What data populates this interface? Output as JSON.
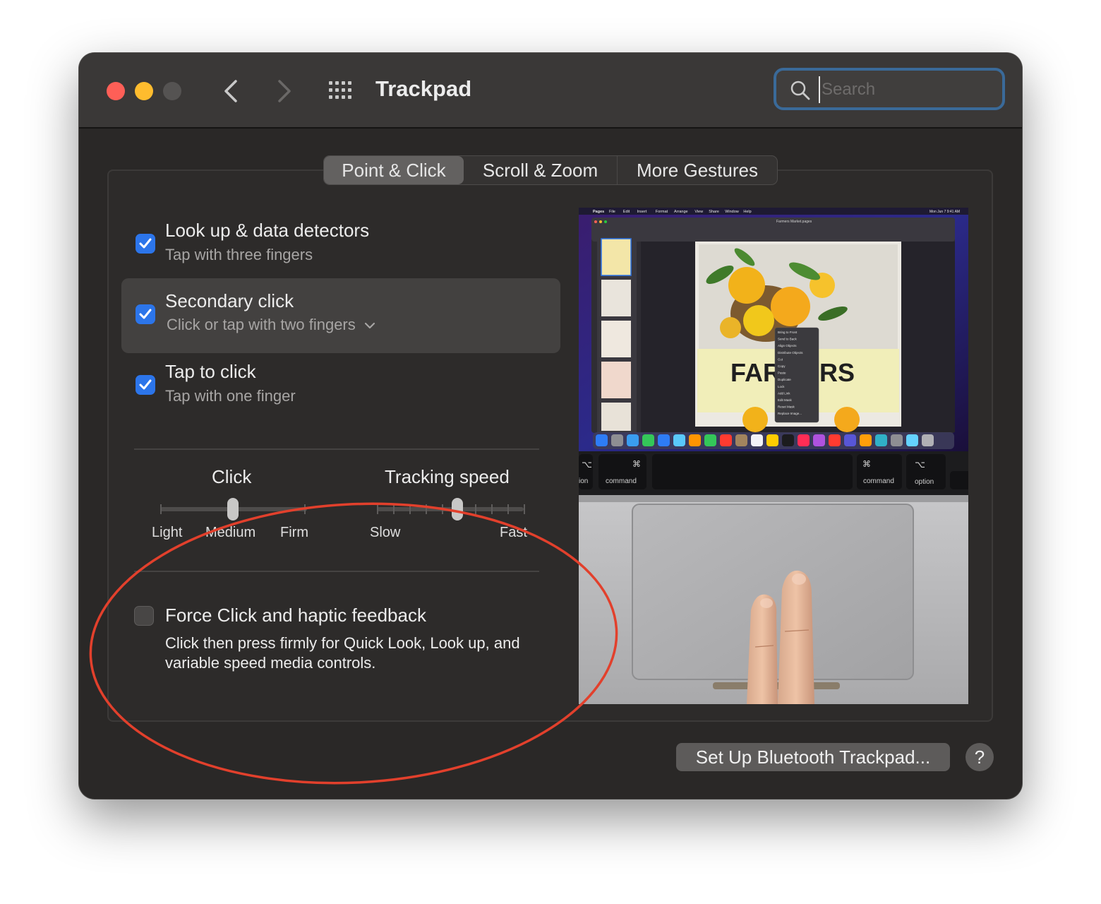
{
  "window": {
    "title": "Trackpad",
    "search_placeholder": "Search"
  },
  "tabs": [
    {
      "label": "Point & Click",
      "selected": true
    },
    {
      "label": "Scroll & Zoom",
      "selected": false
    },
    {
      "label": "More Gestures",
      "selected": false
    }
  ],
  "options": {
    "lookup": {
      "label": "Look up & data detectors",
      "sub": "Tap with three fingers",
      "checked": true
    },
    "secondary": {
      "label": "Secondary click",
      "sub": "Click or tap with two fingers",
      "checked": true
    },
    "tap": {
      "label": "Tap to click",
      "sub": "Tap with one finger",
      "checked": true
    }
  },
  "click_slider": {
    "title": "Click",
    "labels": [
      "Light",
      "Medium",
      "Firm"
    ],
    "value": "Medium"
  },
  "tracking_slider": {
    "title": "Tracking speed",
    "min_label": "Slow",
    "max_label": "Fast",
    "value_fraction": 0.55
  },
  "force_click": {
    "label": "Force Click and haptic feedback",
    "description": "Click then press firmly for Quick Look, Look up, and variable speed media controls.",
    "checked": false
  },
  "preview": {
    "menubar": [
      "Pages",
      "File",
      "Edit",
      "Insert",
      "Format",
      "Arrange",
      "View",
      "Share",
      "Window",
      "Help"
    ],
    "menubar_time": "Mon Jun 7  9:41 AM",
    "doc_title": "Farmers Market.pages",
    "poster_title": "FARMERS",
    "context_menu": [
      "Bring to Front",
      "Send to Back",
      "Align Objects",
      "Distribute Objects",
      "Cut",
      "Copy",
      "Paste",
      "Duplicate",
      "Lock",
      "Add Link",
      "Edit Mask",
      "Reset Mask",
      "Replace Image..."
    ],
    "keys": {
      "left_symbol": "⌥",
      "left_partial": "ion",
      "command_symbol": "⌘",
      "command": "command",
      "option_symbol": "⌥",
      "option": "option"
    }
  },
  "buttons": {
    "setup": "Set Up Bluetooth Trackpad...",
    "help": "?"
  },
  "colors": {
    "accent": "#2c75ea",
    "annotation": "#e2402c"
  }
}
